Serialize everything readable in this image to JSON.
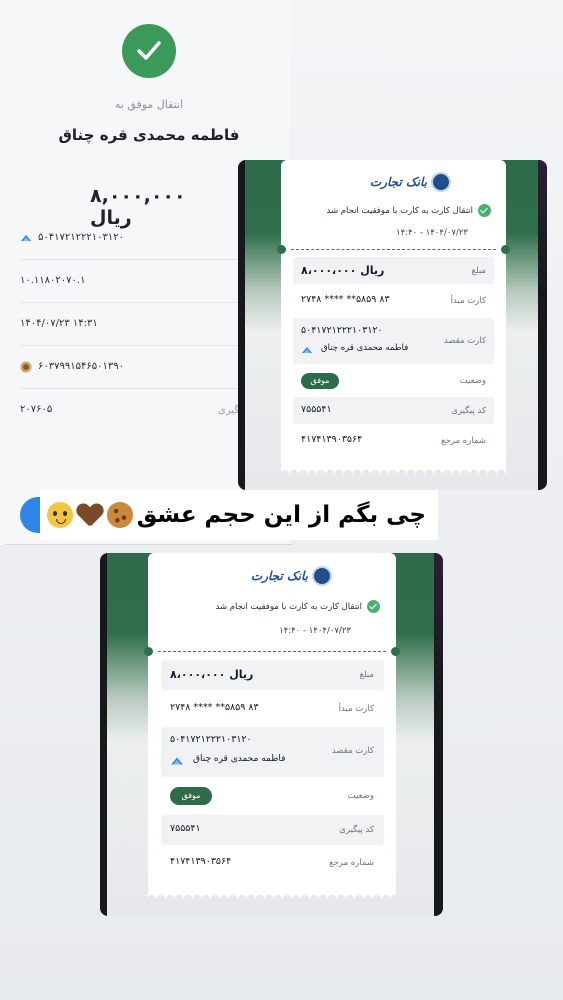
{
  "background_receipt": {
    "status_text": "انتقال موفق به",
    "recipient_name": "فاطمه محمدی قره چناق",
    "amount": "۸,۰۰۰,۰۰۰ ریال",
    "rows": [
      {
        "value": "۵۰۴۱۷۲۱۲۲۲۱۰۳۱۲۰",
        "icon": "bank-logo-icon"
      },
      {
        "value": "۱۰.۱۱۸۰۲۰۷۰.۱",
        "icon": ""
      },
      {
        "value": "۱۴۰۴/۰۷/۲۳   ۱۴:۳۱",
        "icon": ""
      },
      {
        "value": "۶۰۳۷۹۹۱۵۴۶۵۰۱۳۹۰",
        "icon": "bank-badge-icon"
      },
      {
        "value": "۲۰۷۶۰۵",
        "icon": ""
      }
    ],
    "row5_label": "پیگیری"
  },
  "receipt": {
    "bank_name": "بانک تجارت",
    "success_message": "انتقال کارت به کارت با موفقیت انجام شد",
    "timestamp": "۱۴۰۴/۰۷/۲۳ - ۱۴:۴۰",
    "amount_label": "مبلغ",
    "amount_value": "۸،۰۰۰،۰۰۰ ریال",
    "source_card_label": "کارت مبدأ",
    "source_card_value": "۲۷۴۸ **** **۵۸۵۹ ۸۳",
    "dest_card_label": "کارت مقصد",
    "dest_card_value": "۵۰۴۱۷۲۱۲۲۲۱۰۳۱۲۰",
    "dest_name": "فاطمه محمدی قره چناق",
    "status_label": "وضعیت",
    "status_value": "موفق",
    "tracking_label": "کد پیگیری",
    "tracking_value": "۷۵۵۵۴۱",
    "reference_label": "شماره مرجع",
    "reference_value": "۴۱۷۴۱۳۹۰۳۵۶۴"
  },
  "caption": {
    "text": "چی بگم از این حجم  عشق",
    "emojis": [
      "cookie",
      "brown-heart",
      "pleading-face"
    ]
  },
  "colors": {
    "primary_green": "#2e6b4a",
    "success_green": "#3b9a5a",
    "bank_blue": "#1f4f8c",
    "button_blue": "#2f86e8"
  }
}
